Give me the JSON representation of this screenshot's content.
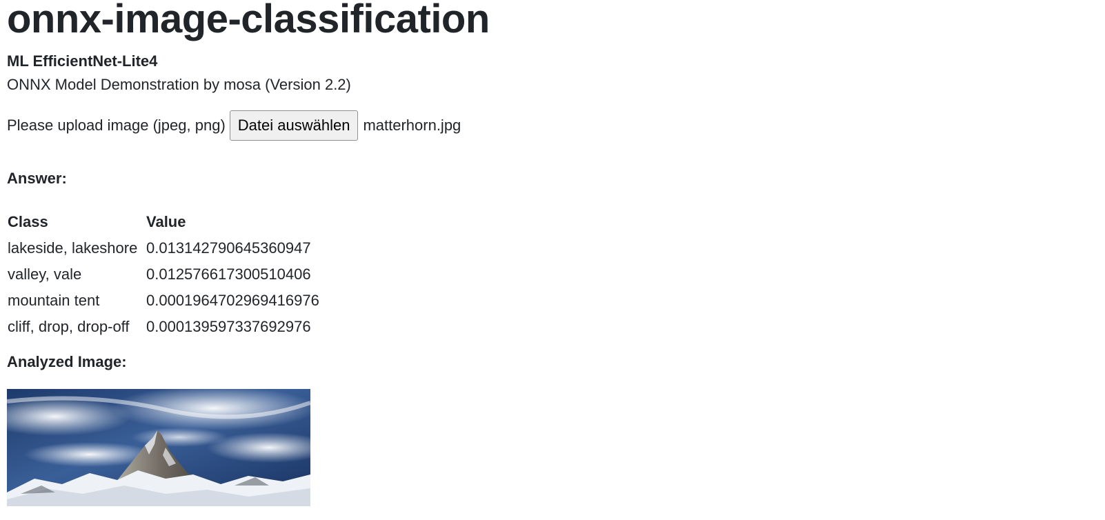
{
  "header": {
    "title": "onnx-image-classification",
    "model": "ML EfficientNet-Lite4",
    "description": "ONNX Model Demonstration by mosa (Version 2.2)"
  },
  "upload": {
    "label": "Please upload image (jpeg, png)",
    "button_label": "Datei auswählen",
    "file_name": "matterhorn.jpg"
  },
  "answer": {
    "heading": "Answer:",
    "columns": [
      "Class",
      "Value"
    ],
    "rows": [
      {
        "class": "lakeside, lakeshore",
        "value": "0.013142790645360947"
      },
      {
        "class": "valley, vale",
        "value": "0.012576617300510406"
      },
      {
        "class": "mountain tent",
        "value": "0.0001964702969416976"
      },
      {
        "class": "cliff, drop, drop-off",
        "value": "0.000139597337692976"
      }
    ]
  },
  "analyzed": {
    "heading": "Analyzed Image:",
    "image_alt": "matterhorn"
  }
}
